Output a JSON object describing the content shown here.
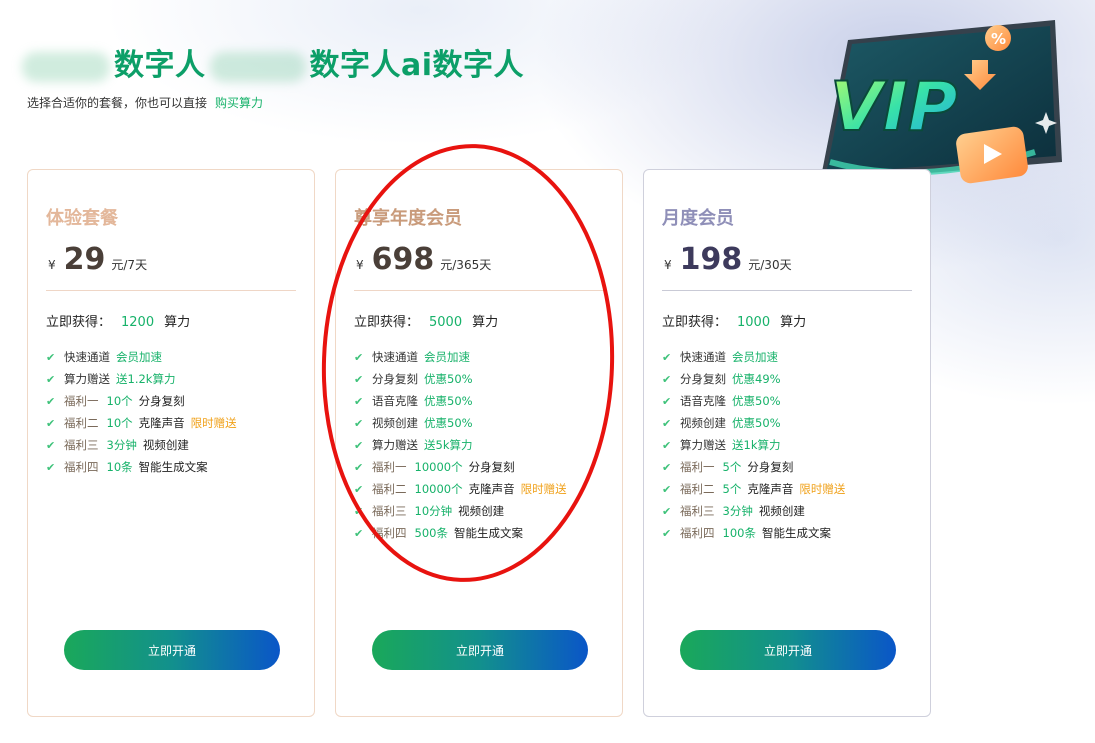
{
  "header": {
    "title": "数字人ai数字人",
    "title_part1": "数字人",
    "title_part2": "数字人ai数字人",
    "subtitle": "选择合适你的套餐，你也可以直接",
    "buy_link": "购买算力"
  },
  "vip_badge": {
    "text": "VIP",
    "percent": "%"
  },
  "plans": [
    {
      "name": "体验套餐",
      "name_color": "#e3b79a",
      "currency": "¥",
      "price": "29",
      "price_color": "#4a3f38",
      "unit": "元/7天",
      "gain_label": "立即获得：",
      "gain_value": "1200",
      "gain_unit": "算力",
      "features": [
        {
          "label": "快速通道",
          "value": "会员加速",
          "extra": "",
          "badge": ""
        },
        {
          "label": "算力赠送",
          "value": "送1.2k算力",
          "extra": "",
          "badge": ""
        },
        {
          "label": "福利一",
          "value": "10个",
          "extra": "分身复刻",
          "badge": ""
        },
        {
          "label": "福利二",
          "value": "10个",
          "extra": "克隆声音",
          "badge": "限时赠送"
        },
        {
          "label": "福利三",
          "value": "3分钟",
          "extra": "视频创建",
          "badge": ""
        },
        {
          "label": "福利四",
          "value": "10条",
          "extra": "智能生成文案",
          "badge": ""
        }
      ],
      "button": "立即开通"
    },
    {
      "name": "尊享年度会员",
      "name_color": "#c99b7b",
      "currency": "¥",
      "price": "698",
      "price_color": "#4a3f38",
      "unit": "元/365天",
      "gain_label": "立即获得：",
      "gain_value": "5000",
      "gain_unit": "算力",
      "features": [
        {
          "label": "快速通道",
          "value": "会员加速",
          "extra": "",
          "badge": ""
        },
        {
          "label": "分身复刻",
          "value": "优惠50%",
          "extra": "",
          "badge": ""
        },
        {
          "label": "语音克隆",
          "value": "优惠50%",
          "extra": "",
          "badge": ""
        },
        {
          "label": "视频创建",
          "value": "优惠50%",
          "extra": "",
          "badge": ""
        },
        {
          "label": "算力赠送",
          "value": "送5k算力",
          "extra": "",
          "badge": ""
        },
        {
          "label": "福利一",
          "value": "10000个",
          "extra": "分身复刻",
          "badge": ""
        },
        {
          "label": "福利二",
          "value": "10000个",
          "extra": "克隆声音",
          "badge": "限时赠送"
        },
        {
          "label": "福利三",
          "value": "10分钟",
          "extra": "视频创建",
          "badge": ""
        },
        {
          "label": "福利四",
          "value": "500条",
          "extra": "智能生成文案",
          "badge": ""
        }
      ],
      "button": "立即开通"
    },
    {
      "name": "月度会员",
      "name_color": "#8f8fb8",
      "currency": "¥",
      "price": "198",
      "price_color": "#3d3a5c",
      "unit": "元/30天",
      "gain_label": "立即获得：",
      "gain_value": "1000",
      "gain_unit": "算力",
      "features": [
        {
          "label": "快速通道",
          "value": "会员加速",
          "extra": "",
          "badge": ""
        },
        {
          "label": "分身复刻",
          "value": "优惠49%",
          "extra": "",
          "badge": ""
        },
        {
          "label": "语音克隆",
          "value": "优惠50%",
          "extra": "",
          "badge": ""
        },
        {
          "label": "视频创建",
          "value": "优惠50%",
          "extra": "",
          "badge": ""
        },
        {
          "label": "算力赠送",
          "value": "送1k算力",
          "extra": "",
          "badge": ""
        },
        {
          "label": "福利一",
          "value": "5个",
          "extra": "分身复刻",
          "badge": ""
        },
        {
          "label": "福利二",
          "value": "5个",
          "extra": "克隆声音",
          "badge": "限时赠送"
        },
        {
          "label": "福利三",
          "value": "3分钟",
          "extra": "视频创建",
          "badge": ""
        },
        {
          "label": "福利四",
          "value": "100条",
          "extra": "智能生成文案",
          "badge": ""
        }
      ],
      "button": "立即开通"
    }
  ],
  "colors": {
    "accent": "#17b26a",
    "title": "#0c9f68",
    "badge": "#f0a11a",
    "annotation": "#e8130f"
  }
}
